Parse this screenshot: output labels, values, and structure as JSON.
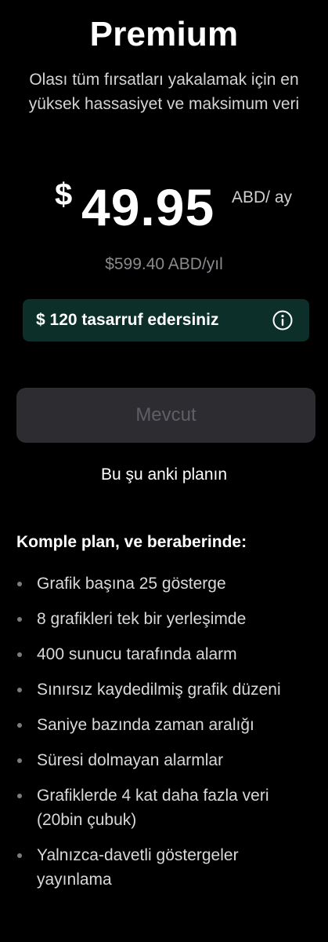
{
  "header": {
    "title": "Premium",
    "subtitle": "Olası tüm fırsatları yakalamak için en yüksek hassasiyet ve maksimum veri"
  },
  "price": {
    "currency": "$",
    "amount": "49.95",
    "period": "ABD/ ay",
    "yearly": "$599.40 ABD/yıl"
  },
  "savings": {
    "text": "$ 120 tasarruf edersiniz",
    "icon": "info-icon",
    "background": "#0d2f2a"
  },
  "plan_button": {
    "label": "Mevcut"
  },
  "current_note": "Bu şu anki planın",
  "features": {
    "title": "Komple plan, ve beraberinde:",
    "items": [
      "Grafik başına 25 gösterge",
      "8 grafikleri tek bir yerleşimde",
      "400 sunucu tarafında alarm",
      "Sınırsız kaydedilmiş grafik düzeni",
      "Saniye bazında zaman aralığı",
      "Süresi dolmayan alarmlar",
      "Grafiklerde 4 kat daha fazla veri (20bin çubuk)",
      "Yalnızca-davetli göstergeler yayınlama"
    ]
  }
}
